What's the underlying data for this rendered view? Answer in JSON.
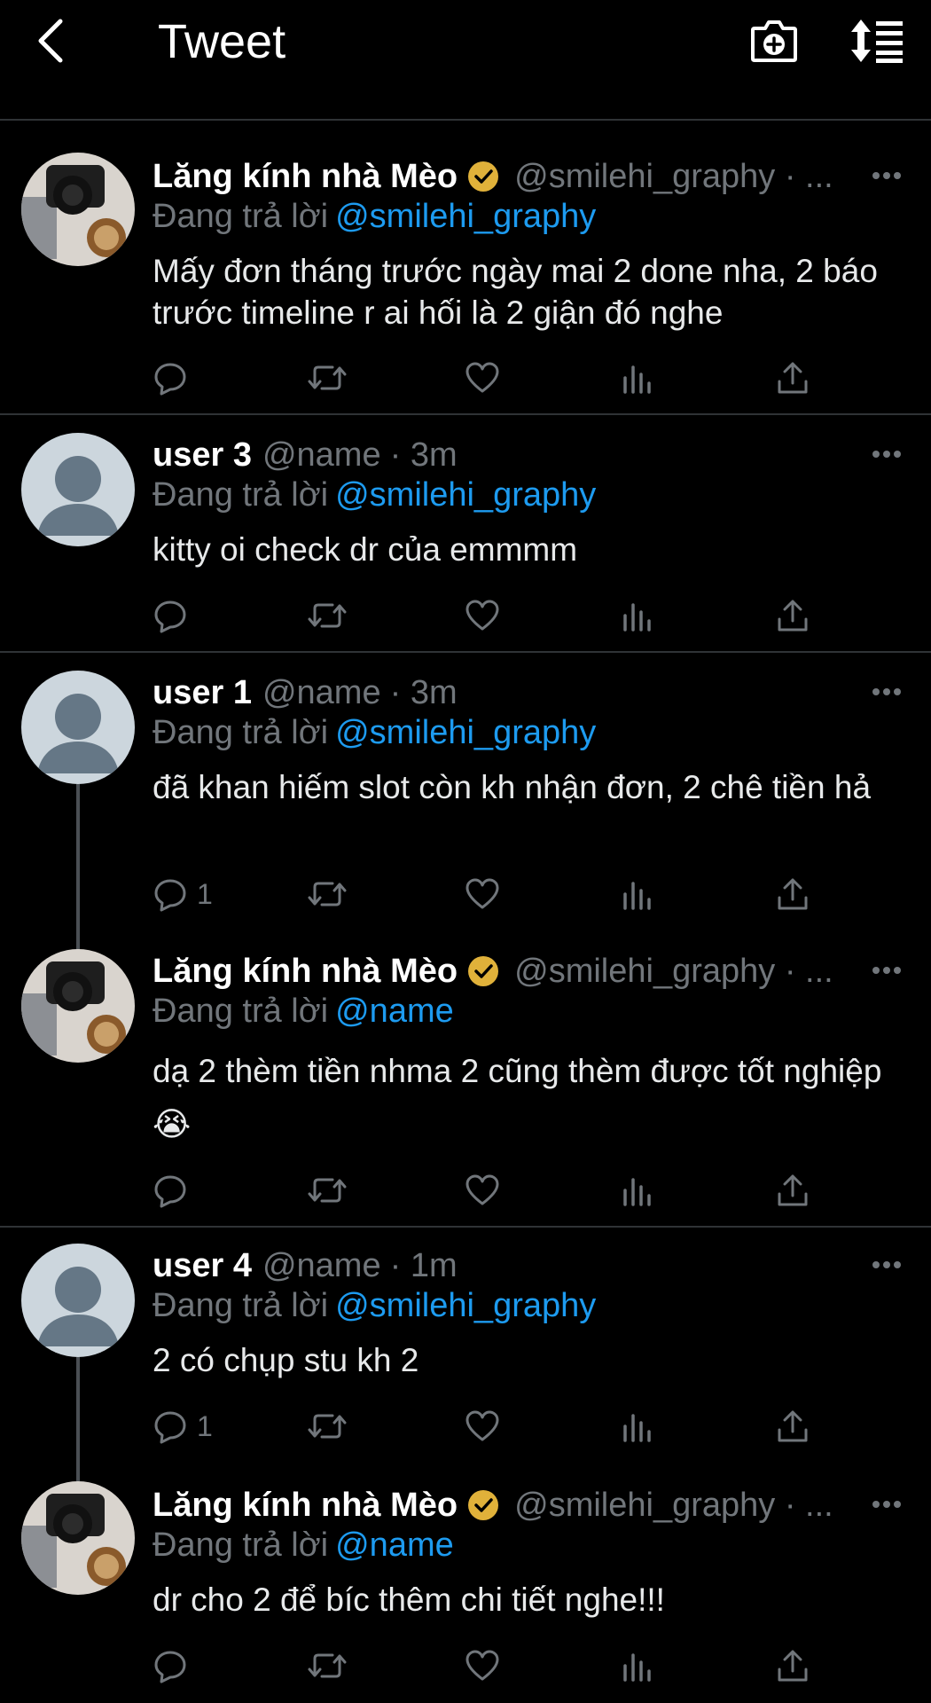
{
  "header": {
    "title": "Tweet"
  },
  "reply_prefix": "Đang trả lời",
  "tweets": [
    {
      "display_name": "Lăng kính nhà Mèo",
      "handle": "@smilehi_graphy · ...",
      "time": "",
      "reply_to": "@smilehi_graphy",
      "text": "Mấy đơn tháng trước ngày mai 2 done nha, 2 báo trước timeline r ai hối là 2 giận đó nghe",
      "reply_count": ""
    },
    {
      "display_name": "user 3",
      "handle": "@name",
      "time": "· 3m",
      "reply_to": "@smilehi_graphy",
      "text": "kitty oi check dr của emmmm",
      "reply_count": ""
    },
    {
      "display_name": "user 1",
      "handle": "@name",
      "time": "· 3m",
      "reply_to": "@smilehi_graphy",
      "text": "đã khan hiếm slot còn kh nhận đơn, 2 chê tiền hả",
      "reply_count": "1"
    },
    {
      "display_name": "Lăng kính nhà Mèo",
      "handle": "@smilehi_graphy · ...",
      "time": "",
      "reply_to": "@name",
      "text": "dạ 2 thèm tiền nhma 2 cũng thèm được tốt nghiệp😭",
      "reply_count": ""
    },
    {
      "display_name": "user 4",
      "handle": "@name",
      "time": "· 1m",
      "reply_to": "@smilehi_graphy",
      "text": "2 có chụp stu kh 2",
      "reply_count": "1"
    },
    {
      "display_name": "Lăng kính nhà Mèo",
      "handle": "@smilehi_graphy · ...",
      "time": "",
      "reply_to": "@name",
      "text": "dr cho 2 để bíc thêm chi tiết nghe!!!",
      "reply_count": ""
    }
  ],
  "icons": {
    "back": "chevron-left-icon",
    "camera": "camera-plus-icon",
    "sort": "sort-icon",
    "verified": "verified-badge-icon",
    "more": "more-icon",
    "reply": "reply-icon",
    "retweet": "retweet-icon",
    "like": "heart-icon",
    "views": "views-icon",
    "share": "share-icon"
  },
  "colors": {
    "background": "#000000",
    "accent": "#1d9bf0",
    "muted": "#71767b",
    "verified": "#e0b13a",
    "separator": "#2f3336"
  }
}
